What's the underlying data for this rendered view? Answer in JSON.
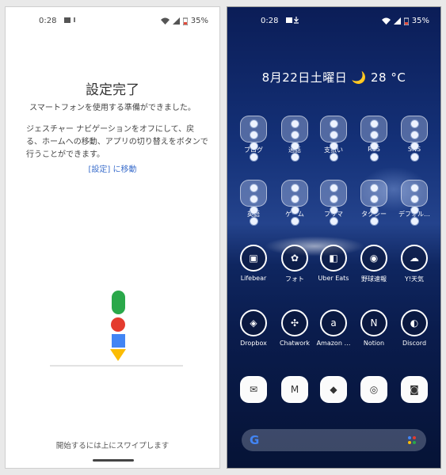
{
  "left_screen": {
    "status": {
      "time": "0:28",
      "battery": "35%"
    },
    "title": "設定完了",
    "subtitle": "スマートフォンを使用する準備ができました。",
    "body": "ジェスチャー ナビゲーションをオフにして、戻る、ホームへの移動、アプリの切り替えをボタンで行うことができます。",
    "link": "[設定] に移動",
    "footer": "開始するには上にスワイプします"
  },
  "right_screen": {
    "status": {
      "time": "0:28",
      "battery": "35%"
    },
    "date_weather": "8月22日土曜日 🌙 28 °C",
    "apps": [
      {
        "label": "ブログ",
        "type": "folder"
      },
      {
        "label": "通話",
        "type": "folder"
      },
      {
        "label": "支払い",
        "type": "folder"
      },
      {
        "label": "RSS",
        "type": "folder"
      },
      {
        "label": "SNS",
        "type": "folder"
      },
      {
        "label": "英語",
        "type": "folder"
      },
      {
        "label": "ゲーム",
        "type": "folder"
      },
      {
        "label": "フリマ",
        "type": "folder"
      },
      {
        "label": "タクシー",
        "type": "folder"
      },
      {
        "label": "デフォル…",
        "type": "folder"
      },
      {
        "label": "Lifebear",
        "icon": "notebook-icon"
      },
      {
        "label": "フォト",
        "icon": "google-photos-icon"
      },
      {
        "label": "Uber Eats",
        "icon": "uber-eats-icon"
      },
      {
        "label": "野球速報",
        "icon": "baseball-icon"
      },
      {
        "label": "Y!天気",
        "icon": "weather-icon"
      },
      {
        "label": "Dropbox",
        "icon": "dropbox-icon"
      },
      {
        "label": "Chatwork",
        "icon": "chatwork-icon"
      },
      {
        "label": "Amazon …",
        "icon": "amazon-icon"
      },
      {
        "label": "Notion",
        "icon": "notion-icon"
      },
      {
        "label": "Discord",
        "icon": "discord-icon"
      },
      {
        "label": "",
        "icon": "messages-icon"
      },
      {
        "label": "",
        "icon": "gmail-icon"
      },
      {
        "label": "",
        "icon": "maps-icon"
      },
      {
        "label": "",
        "icon": "chrome-icon"
      },
      {
        "label": "",
        "icon": "camera-icon"
      }
    ],
    "search_logo": "G"
  },
  "colors": {
    "link": "#3d6fcc",
    "google_green": "#2aa84a",
    "google_red": "#e43b2e",
    "google_blue": "#4285f4",
    "google_yellow": "#fbbc05"
  }
}
